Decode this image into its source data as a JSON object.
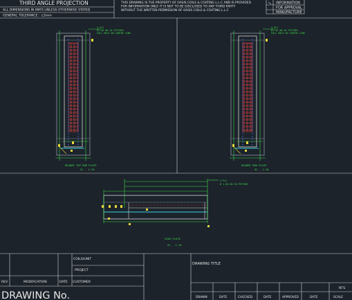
{
  "header": {
    "projection": "THIRD ANGLE PROJECTION",
    "dimensions_note": "ALL DIMENSIONS IN MM'S UNLESS OTHERWISE STATED",
    "tolerance": "GENERAL TOLERANCE : ±2mm",
    "notice_line1": "THIS DRAWING IS THE PROPERTY OF OASIS COILS & COATING L.L.C AND IS PROVIDED",
    "notice_line2": "FOR INFORMATION ONLY. IT IS NOT TO BE DISCLOSED TO ANY THIRD PARTY",
    "notice_line3": "WITHOUT THE WRITTEN PERMISSION OF OASIS COILS & COATING L.L.C",
    "status_1": "INFORMATION",
    "status_2": "FOR APPROVAL",
    "status_3": "MANUFACTURE"
  },
  "views": {
    "left_title": "HEADER TOP END PLATE",
    "left_scale": "SC - 1:10",
    "right_title": "HEADER END PLATE",
    "right_scale": "SC - 1:10",
    "bottom_title": "SIDE PLATE",
    "bottom_scale": "SC - 1:10"
  },
  "annotations": {
    "note_left": "3 PLS",
    "note_left_2": "Ø1.50 ON 20 PITCHES",
    "note_left_3": "FULL HOLE ON CENTRE LINE",
    "note_right": "3 PLS",
    "note_right_2": "Ø1.50 ON 20 PITCHES",
    "note_right_3": "FULL HOLE ON CENTRE LINE",
    "note_bottom": "4 PLS",
    "note_bottom_2": "Ø 1.50 ON 20 PITCHES"
  },
  "title_block": {
    "coils_unit": "COILS/UNIT",
    "project": "PROJECT",
    "customer": "CUSTOMER",
    "rev": "REV",
    "modification": "MODIFICATION",
    "date": "DATE",
    "drawing_no": "DRAWING No.",
    "drawing_title": "DRAWING TITLE",
    "nts": "NTS",
    "cols": [
      "DRAWN",
      "DATE",
      "CHECKED",
      "DATE",
      "APPROVED",
      "DATE",
      "SCALE"
    ]
  }
}
